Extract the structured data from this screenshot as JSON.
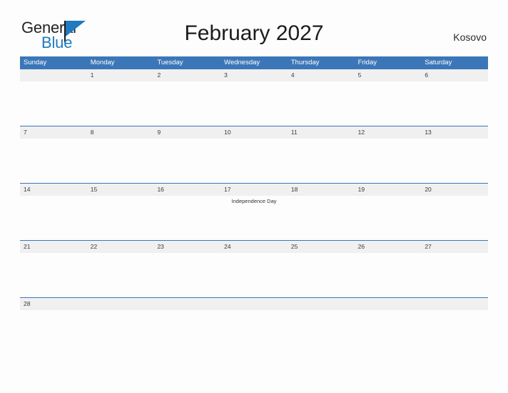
{
  "brand": {
    "name_top": "General",
    "name_bottom": "Blue",
    "accent_color": "#1f7ac0",
    "flag_icon": "flag-triangle-icon"
  },
  "header": {
    "title": "February 2027",
    "country": "Kosovo"
  },
  "calendar": {
    "header_bg": "#3b77b8",
    "date_band_bg": "#f0f0f0",
    "grid_line_color": "#3b77b8",
    "weekdays": [
      "Sunday",
      "Monday",
      "Tuesday",
      "Wednesday",
      "Thursday",
      "Friday",
      "Saturday"
    ],
    "weeks": [
      {
        "days": [
          {
            "date": "",
            "event": ""
          },
          {
            "date": "1",
            "event": ""
          },
          {
            "date": "2",
            "event": ""
          },
          {
            "date": "3",
            "event": ""
          },
          {
            "date": "4",
            "event": ""
          },
          {
            "date": "5",
            "event": ""
          },
          {
            "date": "6",
            "event": ""
          }
        ]
      },
      {
        "days": [
          {
            "date": "7",
            "event": ""
          },
          {
            "date": "8",
            "event": ""
          },
          {
            "date": "9",
            "event": ""
          },
          {
            "date": "10",
            "event": ""
          },
          {
            "date": "11",
            "event": ""
          },
          {
            "date": "12",
            "event": ""
          },
          {
            "date": "13",
            "event": ""
          }
        ]
      },
      {
        "days": [
          {
            "date": "14",
            "event": ""
          },
          {
            "date": "15",
            "event": ""
          },
          {
            "date": "16",
            "event": ""
          },
          {
            "date": "17",
            "event": "Independence Day"
          },
          {
            "date": "18",
            "event": ""
          },
          {
            "date": "19",
            "event": ""
          },
          {
            "date": "20",
            "event": ""
          }
        ]
      },
      {
        "days": [
          {
            "date": "21",
            "event": ""
          },
          {
            "date": "22",
            "event": ""
          },
          {
            "date": "23",
            "event": ""
          },
          {
            "date": "24",
            "event": ""
          },
          {
            "date": "25",
            "event": ""
          },
          {
            "date": "26",
            "event": ""
          },
          {
            "date": "27",
            "event": ""
          }
        ]
      },
      {
        "short": true,
        "days": [
          {
            "date": "28",
            "event": ""
          },
          {
            "date": "",
            "event": ""
          },
          {
            "date": "",
            "event": ""
          },
          {
            "date": "",
            "event": ""
          },
          {
            "date": "",
            "event": ""
          },
          {
            "date": "",
            "event": ""
          },
          {
            "date": "",
            "event": ""
          }
        ]
      }
    ]
  }
}
